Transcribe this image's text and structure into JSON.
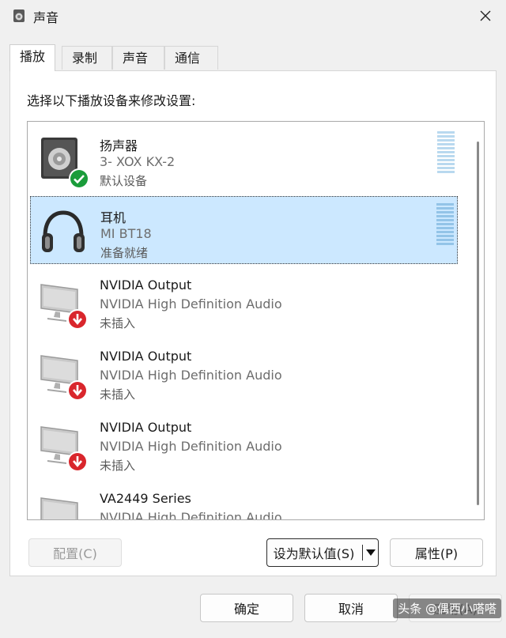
{
  "window": {
    "title": "声音"
  },
  "tabs": [
    {
      "label": "播放"
    },
    {
      "label": "录制"
    },
    {
      "label": "声音"
    },
    {
      "label": "通信"
    }
  ],
  "instruction": "选择以下播放设备来修改设置:",
  "devices": [
    {
      "name": "扬声器",
      "description": "3- XOX KX-2",
      "status": "默认设备",
      "icon": "speaker-icon",
      "badge": "default-check-icon"
    },
    {
      "name": "耳机",
      "description": "MI BT18",
      "status": "准备就绪",
      "icon": "headphones-icon",
      "badge": ""
    },
    {
      "name": "NVIDIA Output",
      "description": "NVIDIA High Definition Audio",
      "status": "未插入",
      "icon": "monitor-icon",
      "badge": "unplugged-arrow-icon"
    },
    {
      "name": "NVIDIA Output",
      "description": "NVIDIA High Definition Audio",
      "status": "未插入",
      "icon": "monitor-icon",
      "badge": "unplugged-arrow-icon"
    },
    {
      "name": "NVIDIA Output",
      "description": "NVIDIA High Definition Audio",
      "status": "未插入",
      "icon": "monitor-icon",
      "badge": "unplugged-arrow-icon"
    },
    {
      "name": "VA2449 Series",
      "description": "NVIDIA High Definition Audio",
      "status": "",
      "icon": "monitor-icon",
      "badge": ""
    }
  ],
  "buttons": {
    "configure": "配置(C)",
    "set_default": "设为默认值(S)",
    "properties": "属性(P)",
    "ok": "确定",
    "cancel": "取消",
    "apply": "应用(A)"
  },
  "watermark": "头条 @偶西小嗒嗒",
  "colors": {
    "selection": "#cce8ff",
    "meter": "#b9d9ef",
    "default_badge": "#1a9c3a",
    "unplugged_badge": "#d9262c"
  }
}
